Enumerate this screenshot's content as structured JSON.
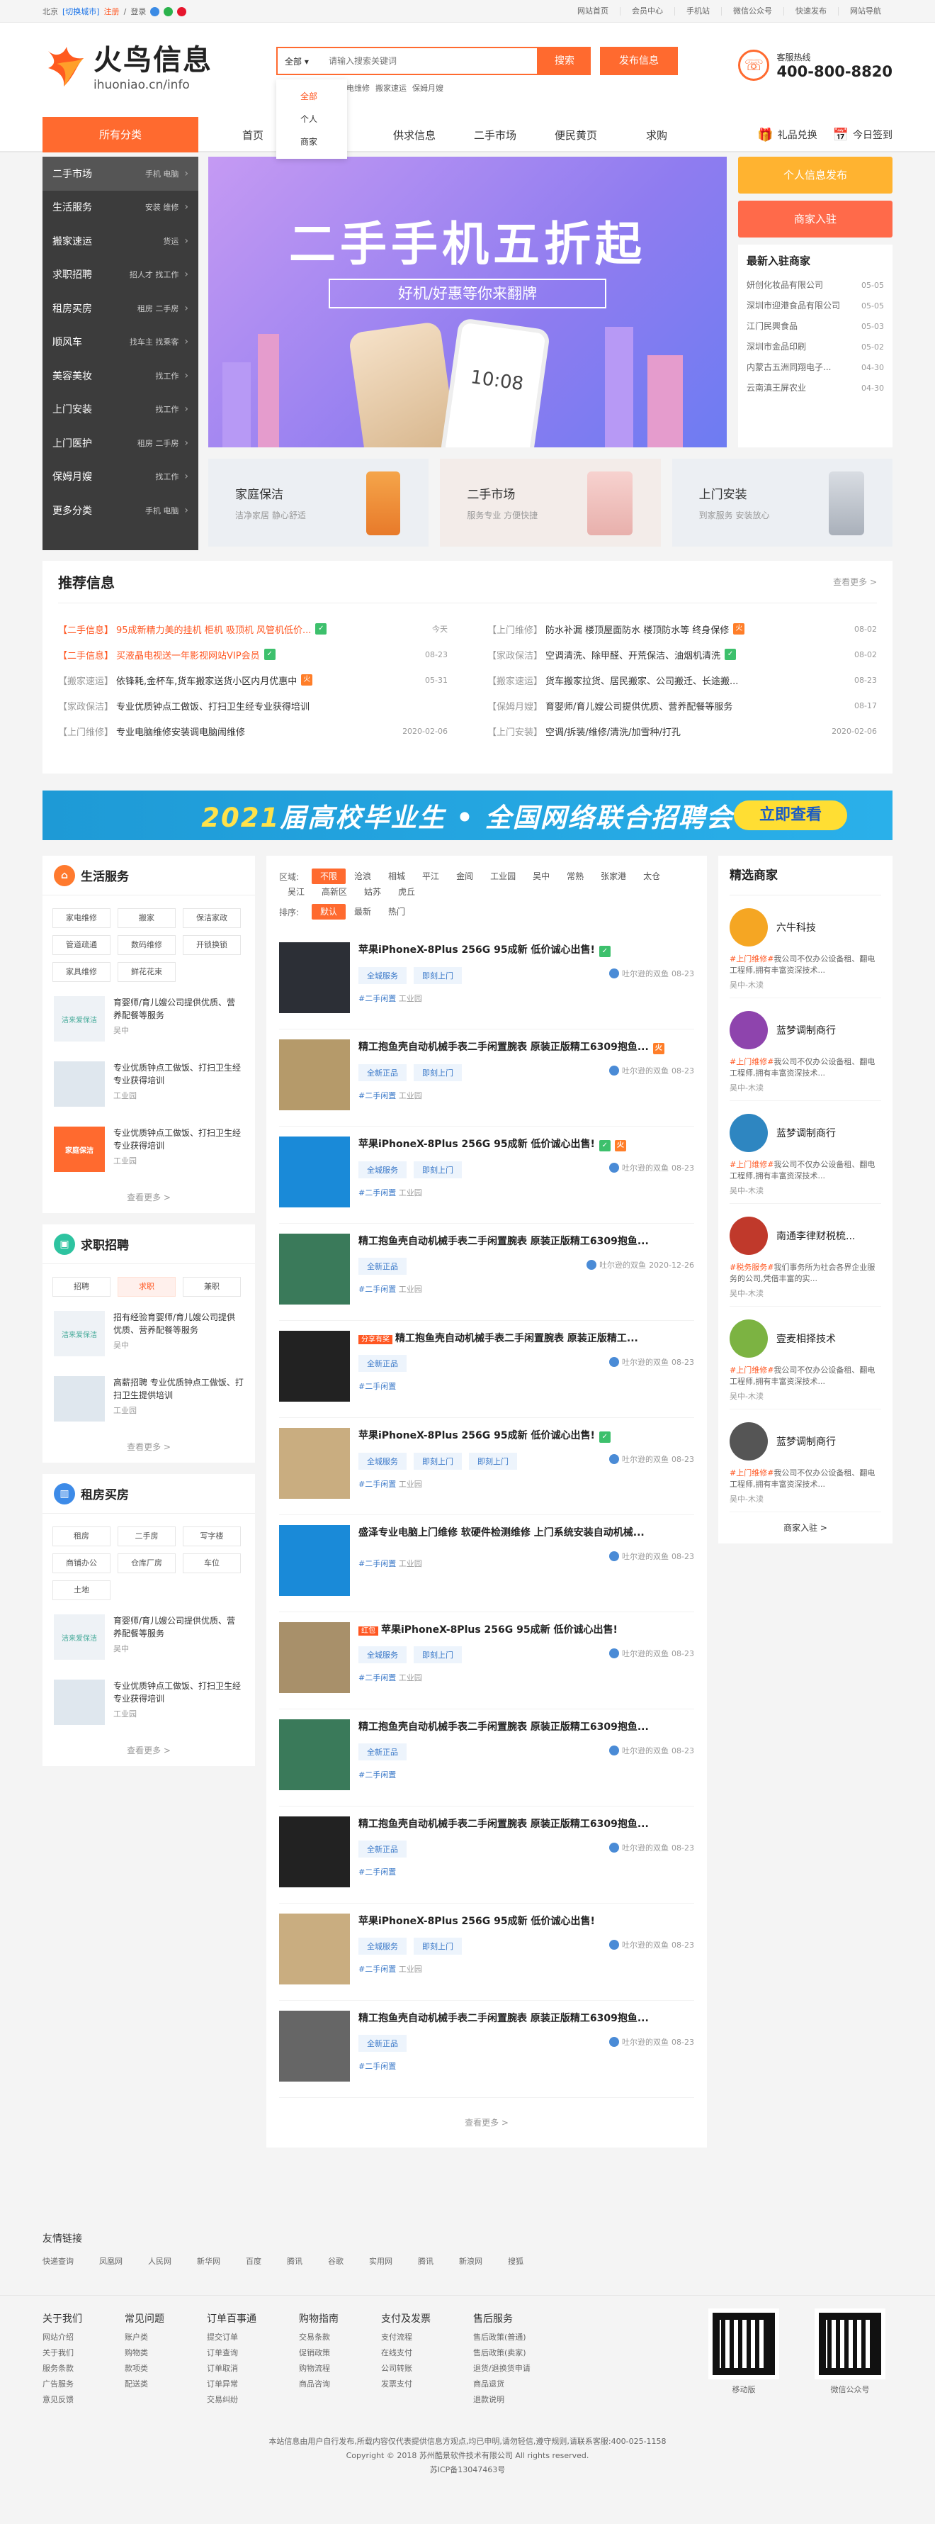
{
  "topbar": {
    "welcome": "北京",
    "switch_city": "[切换城市]",
    "register": "注册",
    "login": "登录",
    "right_links": [
      "网站首页",
      "会员中心",
      "手机站",
      "微信公众号",
      "快速发布",
      "网站导航"
    ]
  },
  "logo": {
    "cn": "火鸟信息",
    "url": "ihuoniao.cn/info"
  },
  "search": {
    "category": "全部",
    "placeholder": "请输入搜索关键词",
    "button": "搜索",
    "publish": "发布信息",
    "hotwords": [
      "家电维修",
      "搬家速运",
      "保姆月嫂"
    ],
    "dropdown": [
      "全部",
      "个人",
      "商家"
    ]
  },
  "hotline": {
    "label": "客服热线",
    "number": "400-800-8820"
  },
  "nav": {
    "all": "所有分类",
    "items": [
      "首页",
      "",
      "供求信息",
      "二手市场",
      "便民黄页",
      "求购"
    ],
    "gift": "礼品兑换",
    "sign": "今日签到"
  },
  "sidebar": [
    {
      "name": "二手市场",
      "sub": "手机  电脑"
    },
    {
      "name": "生活服务",
      "sub": "安装  维修"
    },
    {
      "name": "搬家速运",
      "sub": "货运"
    },
    {
      "name": "求职招聘",
      "sub": "招人才  找工作"
    },
    {
      "name": "租房买房",
      "sub": "租房  二手房"
    },
    {
      "name": "顺风车",
      "sub": "找车主  找乘客"
    },
    {
      "name": "美容美妆",
      "sub": "找工作"
    },
    {
      "name": "上门安装",
      "sub": "找工作"
    },
    {
      "name": "上门医护",
      "sub": "租房  二手房"
    },
    {
      "name": "保姆月嫂",
      "sub": "找工作"
    },
    {
      "name": "更多分类",
      "sub": "手机  电脑"
    }
  ],
  "banner": {
    "title": "二手手机五折起",
    "sub": "好机/好惠等你来翻牌",
    "clock": "10:08"
  },
  "sub_banners": [
    {
      "title": "家庭保洁",
      "desc": "洁净家居 静心舒适"
    },
    {
      "title": "二手市场",
      "desc": "服务专业 方便快捷"
    },
    {
      "title": "上门安装",
      "desc": "到家服务 安装放心"
    }
  ],
  "right": {
    "btn_publish": "个人信息发布",
    "btn_merchant": "商家入驻",
    "new_shops_title": "最新入驻商家",
    "new_shops": [
      {
        "name": "妍创化妆品有限公司",
        "date": "05-05"
      },
      {
        "name": "深圳市迎港食品有限公司",
        "date": "05-05"
      },
      {
        "name": "江门民興食品",
        "date": "05-03"
      },
      {
        "name": "深圳市金品印刷",
        "date": "05-02"
      },
      {
        "name": "内蒙古五洲同翔电子...",
        "date": "04-30"
      },
      {
        "name": "云南滇王屏农业",
        "date": "04-30"
      }
    ]
  },
  "recommend": {
    "title": "推荐信息",
    "more": "查看更多 >",
    "left": [
      {
        "tag": "【二手信息】",
        "text": "95成新精力美的挂机 柜机 吸顶机 风管机低价...",
        "badge": "g",
        "date": "今天",
        "red": true
      },
      {
        "tag": "【二手信息】",
        "text": "买液晶电视送一年影视网站VIP会员",
        "badge": "g",
        "date": "08-23",
        "red": true
      },
      {
        "tag": "【搬家速运】",
        "text": "依锋耗,金杯车,货车搬家送货小区内月优惠中",
        "badge": "o",
        "date": "05-31",
        "red": false
      },
      {
        "tag": "【家政保洁】",
        "text": "专业优质钟点工做饭、打扫卫生经专业获得培训",
        "badge": "",
        "date": "",
        "red": false
      },
      {
        "tag": "【上门维修】",
        "text": "专业电脑维修安装调电脑闹维修",
        "badge": "",
        "date": "2020-02-06",
        "red": false
      }
    ],
    "right": [
      {
        "tag": "【上门维修】",
        "text": "防水补漏 楼顶屋面防水 楼顶防水等 终身保修",
        "badge": "o",
        "date": "08-02"
      },
      {
        "tag": "【家政保洁】",
        "text": "空调清洗、除甲醛、开荒保洁、油烟机清洗",
        "badge": "g",
        "date": "08-02"
      },
      {
        "tag": "【搬家速运】",
        "text": "货车搬家拉货、居民搬家、公司搬迁、长途搬...",
        "badge": "",
        "date": "08-23"
      },
      {
        "tag": "【保姆月嫂】",
        "text": "育婴师/育儿嫂公司提供优质、营养配餐等服务",
        "badge": "",
        "date": "08-17"
      },
      {
        "tag": "【上门安装】",
        "text": "空调/拆装/维修/清洗/加雪种/打孔",
        "badge": "",
        "date": "2020-02-06"
      }
    ]
  },
  "ad": {
    "year": "2021",
    "text": "届高校毕业生 • 全国网络联合招聘会",
    "btn": "立即查看"
  },
  "life": {
    "title": "生活服务",
    "tags": [
      "家电维修",
      "搬家",
      "保洁家政",
      "管道疏通",
      "数码维修",
      "开锁换锁",
      "家具维修",
      "鲜花花束"
    ],
    "items": [
      {
        "thumb": "洁来爱保洁",
        "text": "育婴师/育儿嫂公司提供优质、营养配餐等服务",
        "loc": "吴中"
      },
      {
        "thumb": "",
        "text": "专业优质钟点工做饭、打扫卫生经专业获得培训",
        "loc": "工业园"
      },
      {
        "thumb": "家庭保洁",
        "text": "专业优质钟点工做饭、打扫卫生经专业获得培训",
        "loc": "工业园"
      }
    ],
    "more": "查看更多 >"
  },
  "jobs": {
    "title": "求职招聘",
    "tags": [
      "招聘",
      "求职",
      "兼职"
    ],
    "items": [
      {
        "thumb": "洁来爱保洁",
        "text": "招有经验育婴师/育儿嫂公司提供优质、营养配餐等服务",
        "loc": "吴中"
      },
      {
        "thumb": "",
        "text": "高薪招聘 专业优质钟点工做饭、打扫卫生提供培训",
        "loc": "工业园"
      }
    ],
    "more": "查看更多 >"
  },
  "house": {
    "title": "租房买房",
    "tags": [
      "租房",
      "二手房",
      "写字楼",
      "商铺办公",
      "仓库厂房",
      "车位",
      "土地"
    ],
    "items": [
      {
        "thumb": "洁来爱保洁",
        "text": "育婴师/育儿嫂公司提供优质、营养配餐等服务",
        "loc": "吴中"
      },
      {
        "thumb": "",
        "text": "专业优质钟点工做饭、打扫卫生经专业获得培训",
        "loc": "工业园"
      }
    ],
    "more": "查看更多 >"
  },
  "filter": {
    "area_label": "区域:",
    "areas": [
      "不限",
      "沧浪",
      "相城",
      "平江",
      "金阊",
      "工业园",
      "吴中",
      "常熟",
      "张家港",
      "太仓",
      "吴江",
      "高新区",
      "姑苏",
      "虎丘"
    ],
    "sort_label": "排序:",
    "sorts": [
      "默认",
      "最新",
      "热门"
    ]
  },
  "listings": [
    {
      "title": "苹果iPhoneX-8Plus 256G 95成新 低价诚心出售!",
      "chips": [
        "全城服务",
        "即刻上门"
      ],
      "badges": [
        "g"
      ],
      "user": "吐尔逊的双鱼",
      "date": "08-23",
      "cat": "#二手闲置",
      "area": "工业园",
      "thumb": "#2c2f36",
      "hot": ""
    },
    {
      "title": "精工抱鱼壳自动机械手表二手闲置腕表 原装正版精工6309抱鱼...",
      "chips": [
        "全新正品",
        "即刻上门"
      ],
      "badges": [
        "o"
      ],
      "user": "吐尔逊的双鱼",
      "date": "08-23",
      "cat": "#二手闲置",
      "area": "工业园",
      "thumb": "#b59a6a",
      "hot": ""
    },
    {
      "title": "苹果iPhoneX-8Plus 256G 95成新 低价诚心出售!",
      "chips": [
        "全城服务",
        "即刻上门"
      ],
      "badges": [
        "g",
        "o"
      ],
      "user": "吐尔逊的双鱼",
      "date": "08-23",
      "cat": "#二手闲置",
      "area": "工业园",
      "thumb": "#1a8ad8",
      "hot": ""
    },
    {
      "title": "精工抱鱼壳自动机械手表二手闲置腕表 原装正版精工6309抱鱼...",
      "chips": [
        "全新正品"
      ],
      "badges": [],
      "user": "吐尔逊的双鱼",
      "date": "2020-12-26",
      "cat": "#二手闲置",
      "area": "工业园",
      "thumb": "#3a7a5a",
      "hot": ""
    },
    {
      "title": "精工抱鱼壳自动机械手表二手闲置腕表 原装正版精工...",
      "chips": [
        "全新正品"
      ],
      "badges": [],
      "user": "吐尔逊的双鱼",
      "date": "08-23",
      "cat": "#二手闲置",
      "area": "",
      "thumb": "#222",
      "hot": "分享有奖"
    },
    {
      "title": "苹果iPhoneX-8Plus 256G 95成新 低价诚心出售!",
      "chips": [
        "全城服务",
        "即刻上门",
        "即刻上门"
      ],
      "badges": [
        "g"
      ],
      "user": "吐尔逊的双鱼",
      "date": "08-23",
      "cat": "#二手闲置",
      "area": "工业园",
      "thumb": "#c9ad80",
      "hot": ""
    },
    {
      "title": "盛泽专业电脑上门维修 软硬件检测维修 上门系统安装自动机械...",
      "chips": [],
      "badges": [],
      "user": "吐尔逊的双鱼",
      "date": "08-23",
      "cat": "#二手闲置",
      "area": "工业园",
      "thumb": "#1a8ad8",
      "hot": ""
    },
    {
      "title": "苹果iPhoneX-8Plus 256G 95成新 低价诚心出售!",
      "chips": [
        "全城服务",
        "即刻上门"
      ],
      "badges": [],
      "user": "吐尔逊的双鱼",
      "date": "08-23",
      "cat": "#二手闲置",
      "area": "工业园",
      "thumb": "#a8906a",
      "hot": "红包"
    },
    {
      "title": "精工抱鱼壳自动机械手表二手闲置腕表 原装正版精工6309抱鱼...",
      "chips": [
        "全新正品"
      ],
      "badges": [],
      "user": "吐尔逊的双鱼",
      "date": "08-23",
      "cat": "#二手闲置",
      "area": "",
      "thumb": "#3a7a5a",
      "hot": ""
    },
    {
      "title": "精工抱鱼壳自动机械手表二手闲置腕表 原装正版精工6309抱鱼...",
      "chips": [
        "全新正品"
      ],
      "badges": [],
      "user": "吐尔逊的双鱼",
      "date": "08-23",
      "cat": "#二手闲置",
      "area": "",
      "thumb": "#222",
      "hot": ""
    },
    {
      "title": "苹果iPhoneX-8Plus 256G 95成新 低价诚心出售!",
      "chips": [
        "全城服务",
        "即刻上门"
      ],
      "badges": [],
      "user": "吐尔逊的双鱼",
      "date": "08-23",
      "cat": "#二手闲置",
      "area": "工业园",
      "thumb": "#c9ad80",
      "hot": ""
    },
    {
      "title": "精工抱鱼壳自动机械手表二手闲置腕表 原装正版精工6309抱鱼...",
      "chips": [
        "全新正品"
      ],
      "badges": [],
      "user": "吐尔逊的双鱼",
      "date": "08-23",
      "cat": "#二手闲置",
      "area": "",
      "thumb": "#666",
      "hot": ""
    }
  ],
  "list_more": "查看更多 >",
  "shops": {
    "title": "精选商家",
    "items": [
      {
        "name": "六牛科技",
        "tag": "#上门维修#",
        "desc": "我公司不仅办公设备租、翻电工程师,拥有丰富资深技术...",
        "loc": "吴中-木渎",
        "color": "#f5a623"
      },
      {
        "name": "蓝梦调制商行",
        "tag": "#上门维修#",
        "desc": "我公司不仅办公设备租、翻电工程师,拥有丰富资深技术...",
        "loc": "吴中-木渎",
        "color": "#8e44ad"
      },
      {
        "name": "蓝梦调制商行",
        "tag": "#上门维修#",
        "desc": "我公司不仅办公设备租、翻电工程师,拥有丰富资深技术...",
        "loc": "吴中-木渎",
        "color": "#2e86c1"
      },
      {
        "name": "南通李律财税梳...",
        "tag": "#税务服务#",
        "desc": "我们事务所为社会各界企业服务的公司,凭借丰富的实...",
        "loc": "吴中-木渎",
        "color": "#c0392b"
      },
      {
        "name": "壹麦相择技术",
        "tag": "#上门维修#",
        "desc": "我公司不仅办公设备租、翻电工程师,拥有丰富资深技术...",
        "loc": "吴中-木渎",
        "color": "#7cb342"
      },
      {
        "name": "蓝梦调制商行",
        "tag": "#上门维修#",
        "desc": "我公司不仅办公设备租、翻电工程师,拥有丰富资深技术...",
        "loc": "吴中-木渎",
        "color": "#555"
      }
    ],
    "more": "商家入驻 >"
  },
  "friend_links": {
    "title": "友情链接",
    "items": [
      "快递查询",
      "凤凰网",
      "人民网",
      "新华网",
      "百度",
      "腾讯",
      "谷歌",
      "实用网",
      "腾讯",
      "新浪网",
      "搜狐"
    ]
  },
  "footer": {
    "cols": [
      {
        "title": "关于我们",
        "items": [
          "网站介绍",
          "关于我们",
          "服务条款",
          "广告服务",
          "意见反馈"
        ]
      },
      {
        "title": "常见问题",
        "items": [
          "账户类",
          "购物类",
          "款项类",
          "配送类"
        ]
      },
      {
        "title": "订单百事通",
        "items": [
          "提交订单",
          "订单查询",
          "订单取消",
          "订单异常",
          "交易纠纷"
        ]
      },
      {
        "title": "购物指南",
        "items": [
          "交易条款",
          "促销政策",
          "购物流程",
          "商品咨询"
        ]
      },
      {
        "title": "支付及发票",
        "items": [
          "支付流程",
          "在线支付",
          "公司转账",
          "发票支付"
        ]
      },
      {
        "title": "售后服务",
        "items": [
          "售后政策(普通)",
          "售后政策(卖家)",
          "退货/退换货申请",
          "商品退货",
          "退款说明"
        ]
      }
    ],
    "qr1": "移动版",
    "qr2": "微信公众号",
    "copy1": "本站信息由用户自行发布,所载内容仅代表提供信息方观点,均已申明,请勿轻信,遵守规则,请联系客服:400-025-1158",
    "copy2": "Copyright © 2018 苏州酷景软件技术有限公司 All rights reserved.",
    "copy3": "苏ICP备13047463号"
  }
}
